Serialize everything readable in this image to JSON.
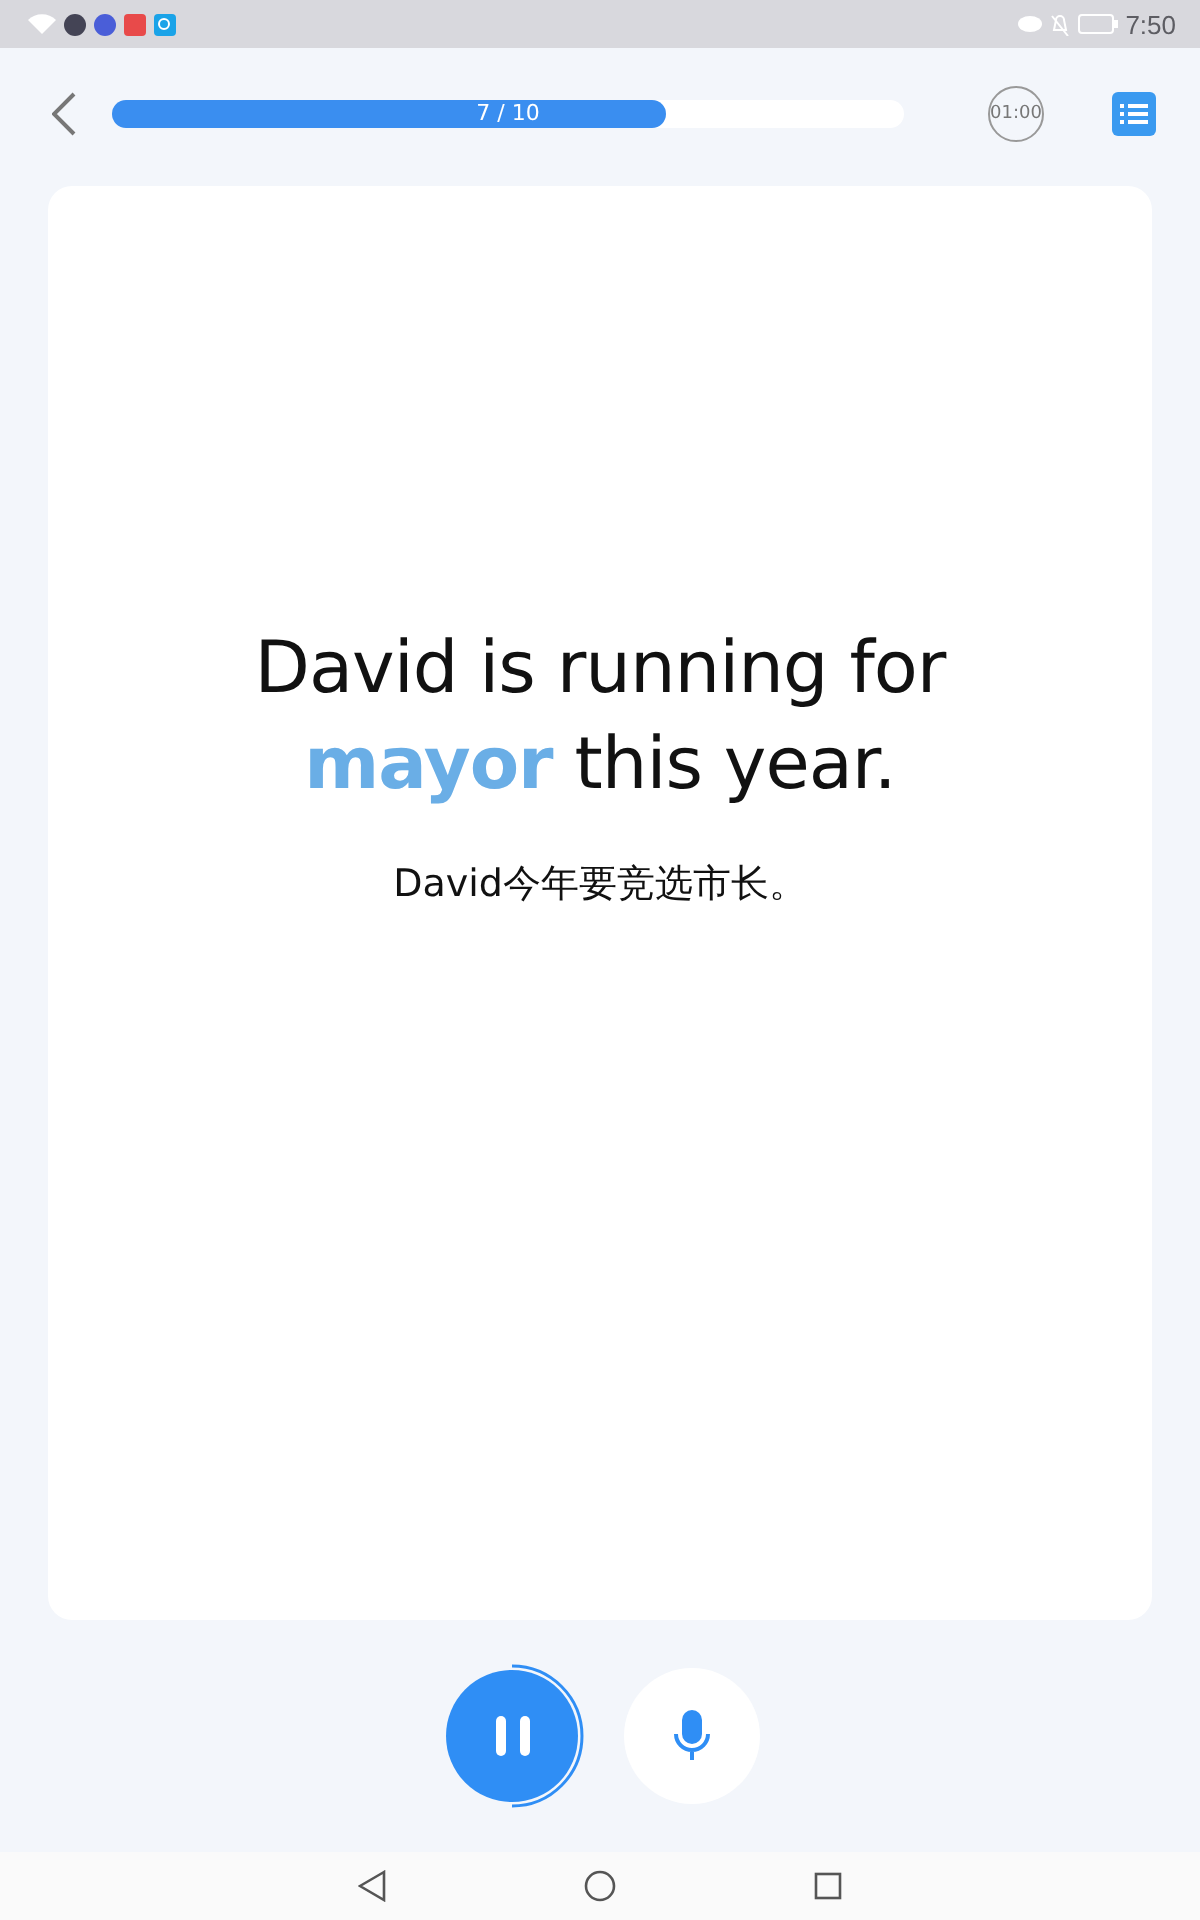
{
  "status_bar": {
    "time": "7:50"
  },
  "progress": {
    "label": "7 / 10",
    "level": 0.7
  },
  "timer": "01:00",
  "card": {
    "sentence": [
      {
        "text": "David is running for ",
        "highlight": false
      },
      {
        "text": "mayor",
        "highlight": true
      },
      {
        "text": " this year.",
        "highlight": false
      }
    ],
    "translation": "David今年要竞选市长。"
  },
  "playback": {
    "playing": true
  }
}
